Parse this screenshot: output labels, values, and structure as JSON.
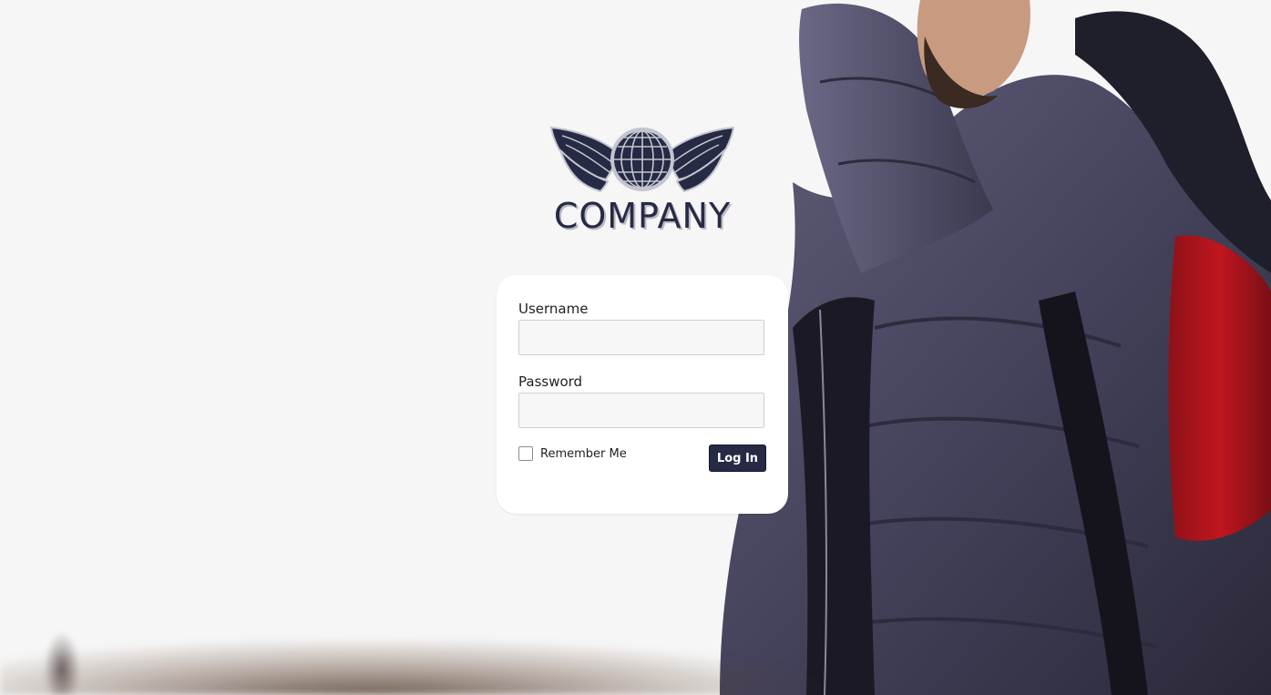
{
  "logo": {
    "text": "COMPANY",
    "icon": "winged-globe-icon"
  },
  "login_form": {
    "username_label": "Username",
    "username_value": "",
    "password_label": "Password",
    "password_value": "",
    "remember_label": "Remember Me",
    "remember_checked": false,
    "submit_label": "Log In"
  },
  "colors": {
    "brand": "#262a44",
    "background": "#f6f6f6"
  }
}
